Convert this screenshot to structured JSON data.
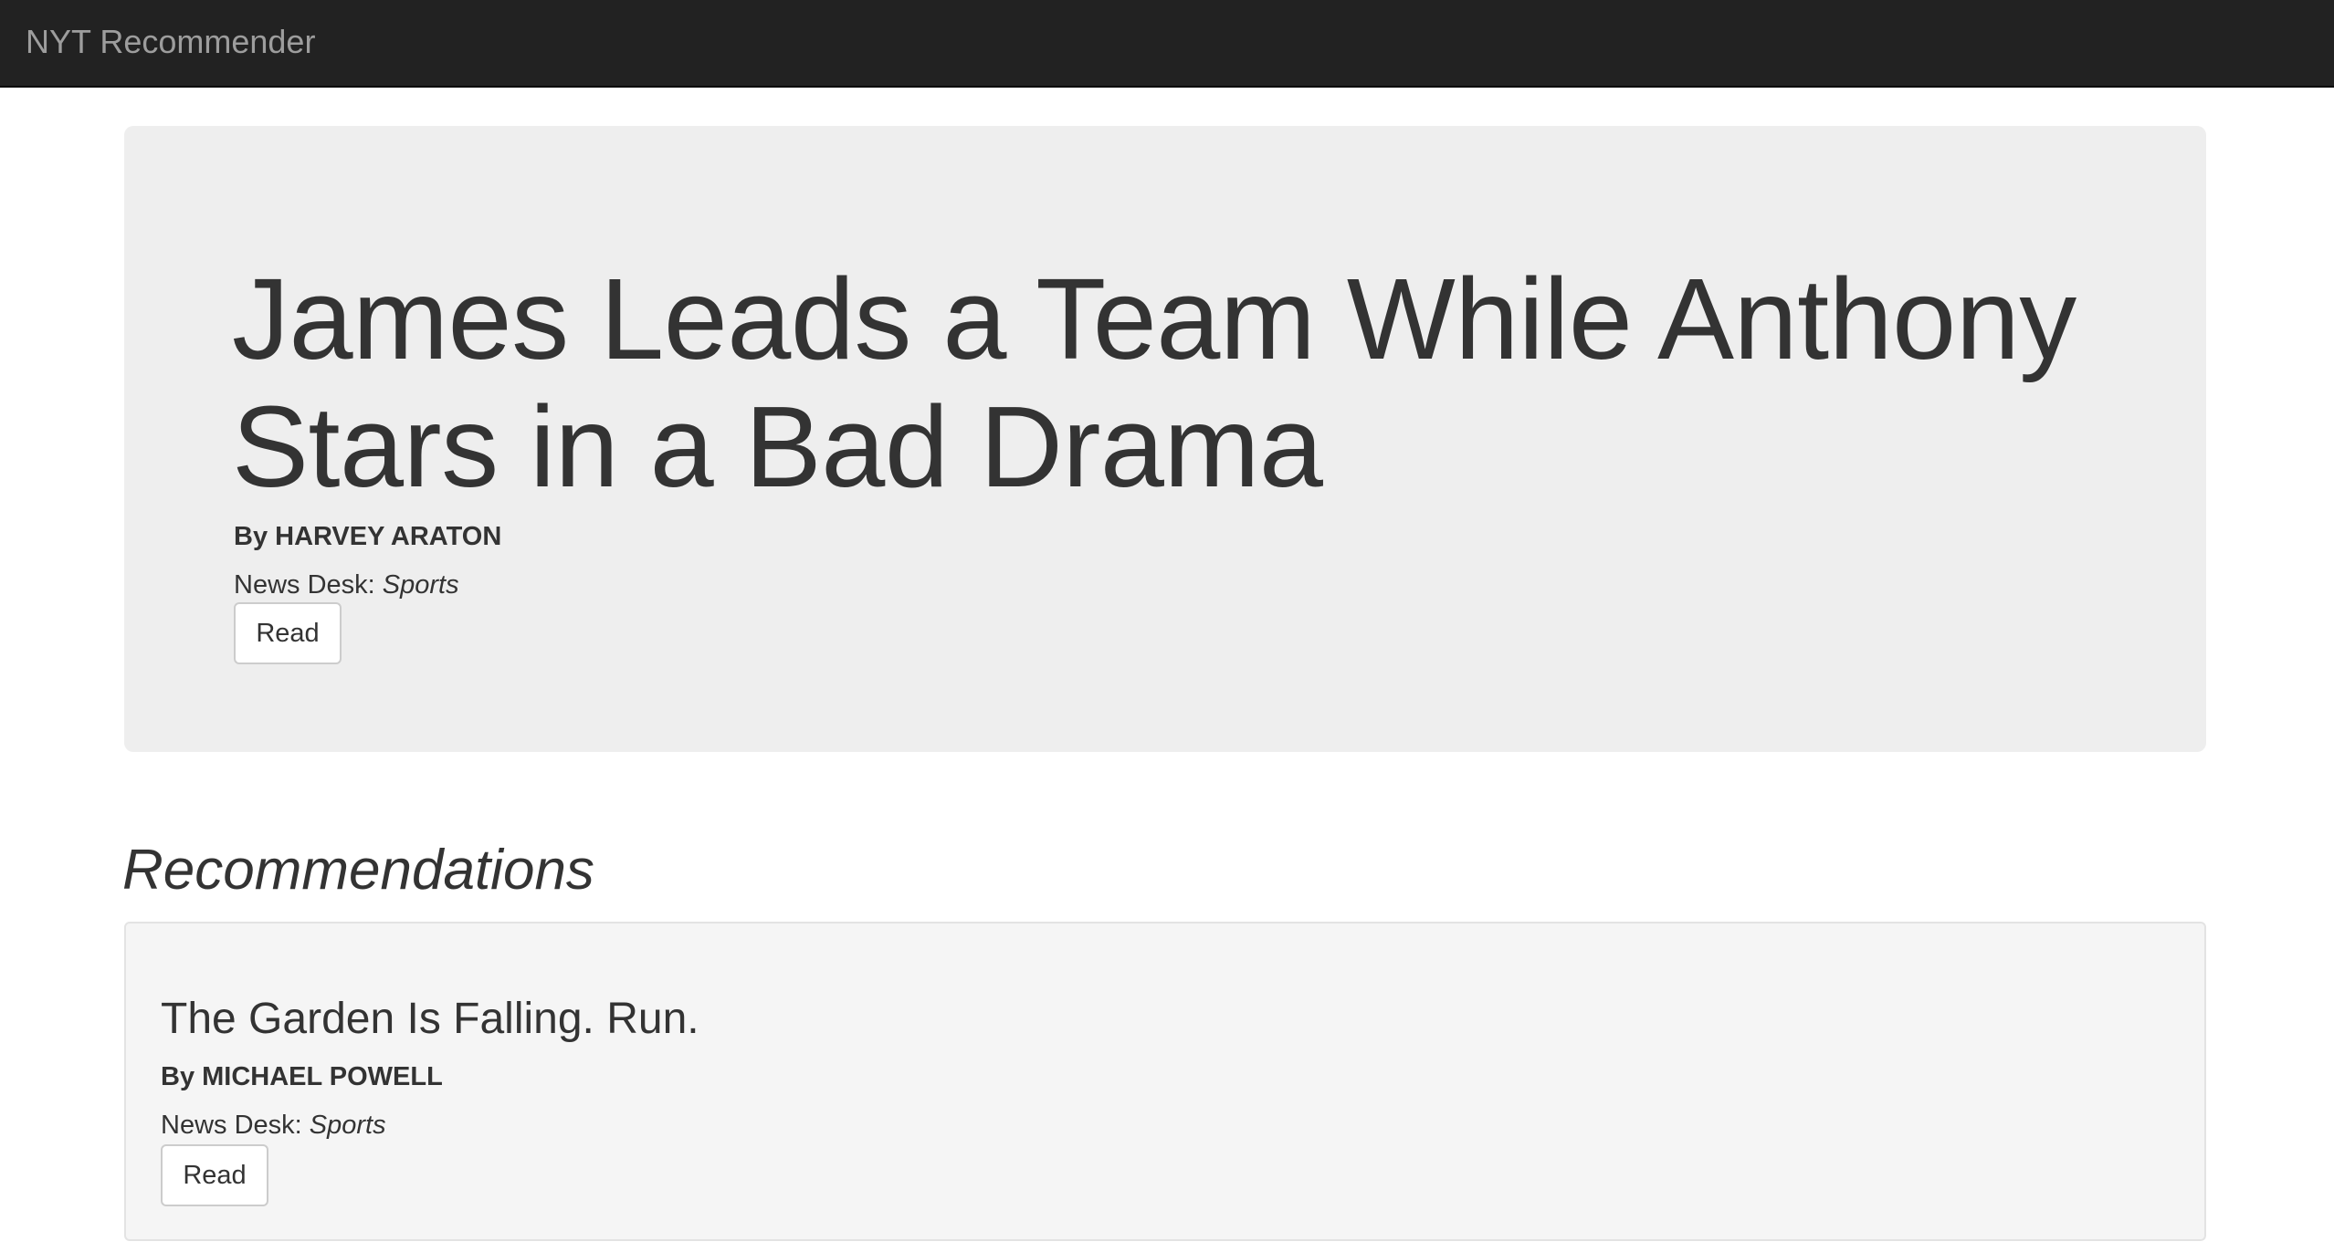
{
  "navbar": {
    "brand": "NYT Recommender"
  },
  "featured": {
    "title": "James Leads a Team While Anthony Stars in a Bad Drama",
    "byline": "By HARVEY ARATON",
    "desk_label": "News Desk:",
    "desk_value": "Sports",
    "read_label": "Read"
  },
  "recommendations": {
    "heading": "Recommendations",
    "items": [
      {
        "title": "The Garden Is Falling. Run.",
        "byline": "By MICHAEL POWELL",
        "desk_label": "News Desk:",
        "desk_value": "Sports",
        "read_label": "Read"
      }
    ]
  }
}
